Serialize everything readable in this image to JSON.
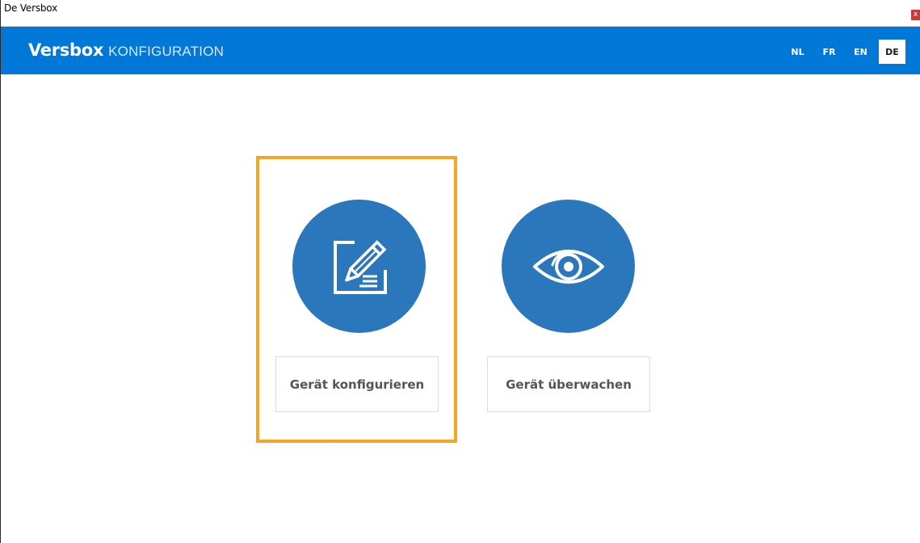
{
  "window": {
    "title": "De Versbox",
    "close_glyph": "x"
  },
  "header": {
    "brand_name": "Versbox",
    "brand_sub": "KONFIGURATION",
    "bar_color": "#0078d7",
    "languages": [
      {
        "code": "NL",
        "active": false
      },
      {
        "code": "FR",
        "active": false
      },
      {
        "code": "EN",
        "active": false
      },
      {
        "code": "DE",
        "active": true
      }
    ]
  },
  "main": {
    "options": [
      {
        "label": "Gerät konfigurieren",
        "icon": "edit-document-icon",
        "selected": true
      },
      {
        "label": "Gerät überwachen",
        "icon": "eye-icon",
        "selected": false
      }
    ],
    "circle_color": "#2a77bb",
    "selection_color": "#f5a623"
  }
}
